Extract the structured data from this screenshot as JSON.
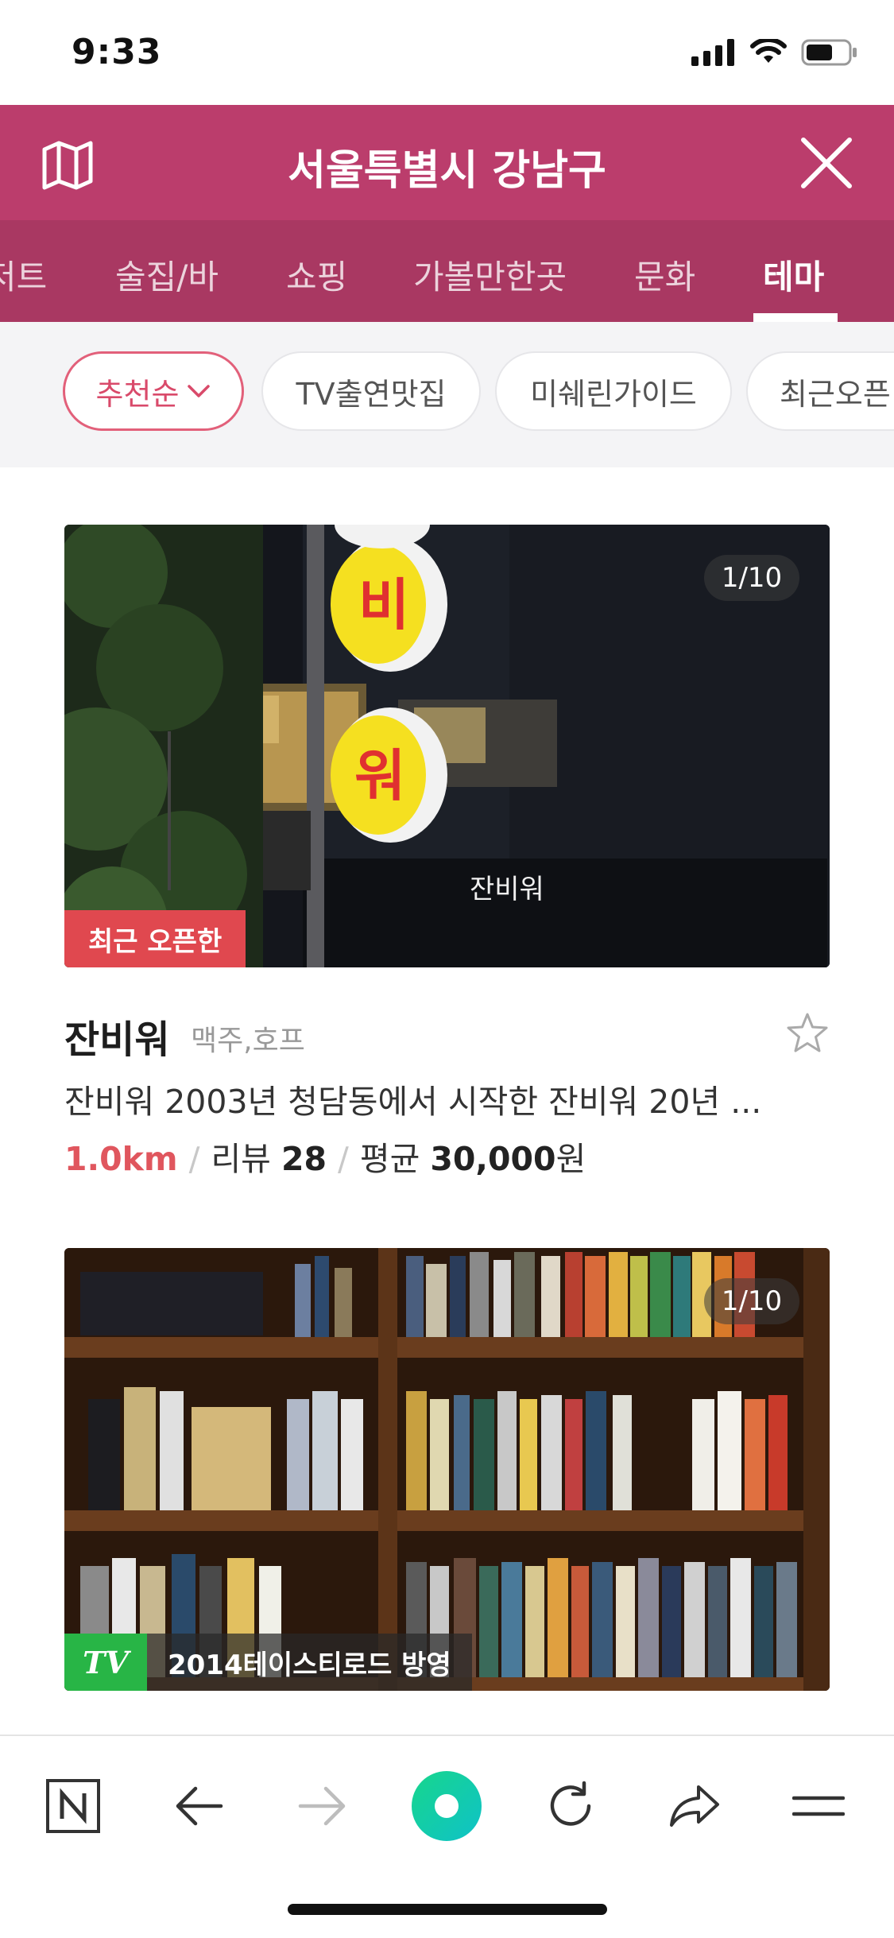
{
  "status": {
    "time": "9:33"
  },
  "header": {
    "title": "서울특별시 강남구"
  },
  "tabs": [
    {
      "label": "저트"
    },
    {
      "label": "술집/바"
    },
    {
      "label": "쇼핑"
    },
    {
      "label": "가볼만한곳"
    },
    {
      "label": "문화"
    },
    {
      "label": "테마"
    }
  ],
  "filters": [
    {
      "label": "추천순"
    },
    {
      "label": "TV출연맛집"
    },
    {
      "label": "미쉐린가이드"
    },
    {
      "label": "최근오픈"
    }
  ],
  "cards": [
    {
      "counter": "1/10",
      "badge": "최근 오픈한",
      "name": "잔비워",
      "category": "맥주,호프",
      "description": "잔비워 2003년 청담동에서 시작한 잔비워 20년 ...",
      "distance": "1.0km",
      "review_label": "리뷰",
      "review_count": "28",
      "avg_label": "평균",
      "avg_price": "30,000",
      "price_unit": "원"
    },
    {
      "counter": "1/10",
      "badge_tv": "TV",
      "badge_text": "2014테이스티로드 방영"
    }
  ],
  "colors": {
    "header_bg": "#bb3d6c",
    "tabs_bg": "#a93862",
    "accent_red": "#e0484f",
    "distance": "#e0565e",
    "tv_green": "#28b546"
  }
}
